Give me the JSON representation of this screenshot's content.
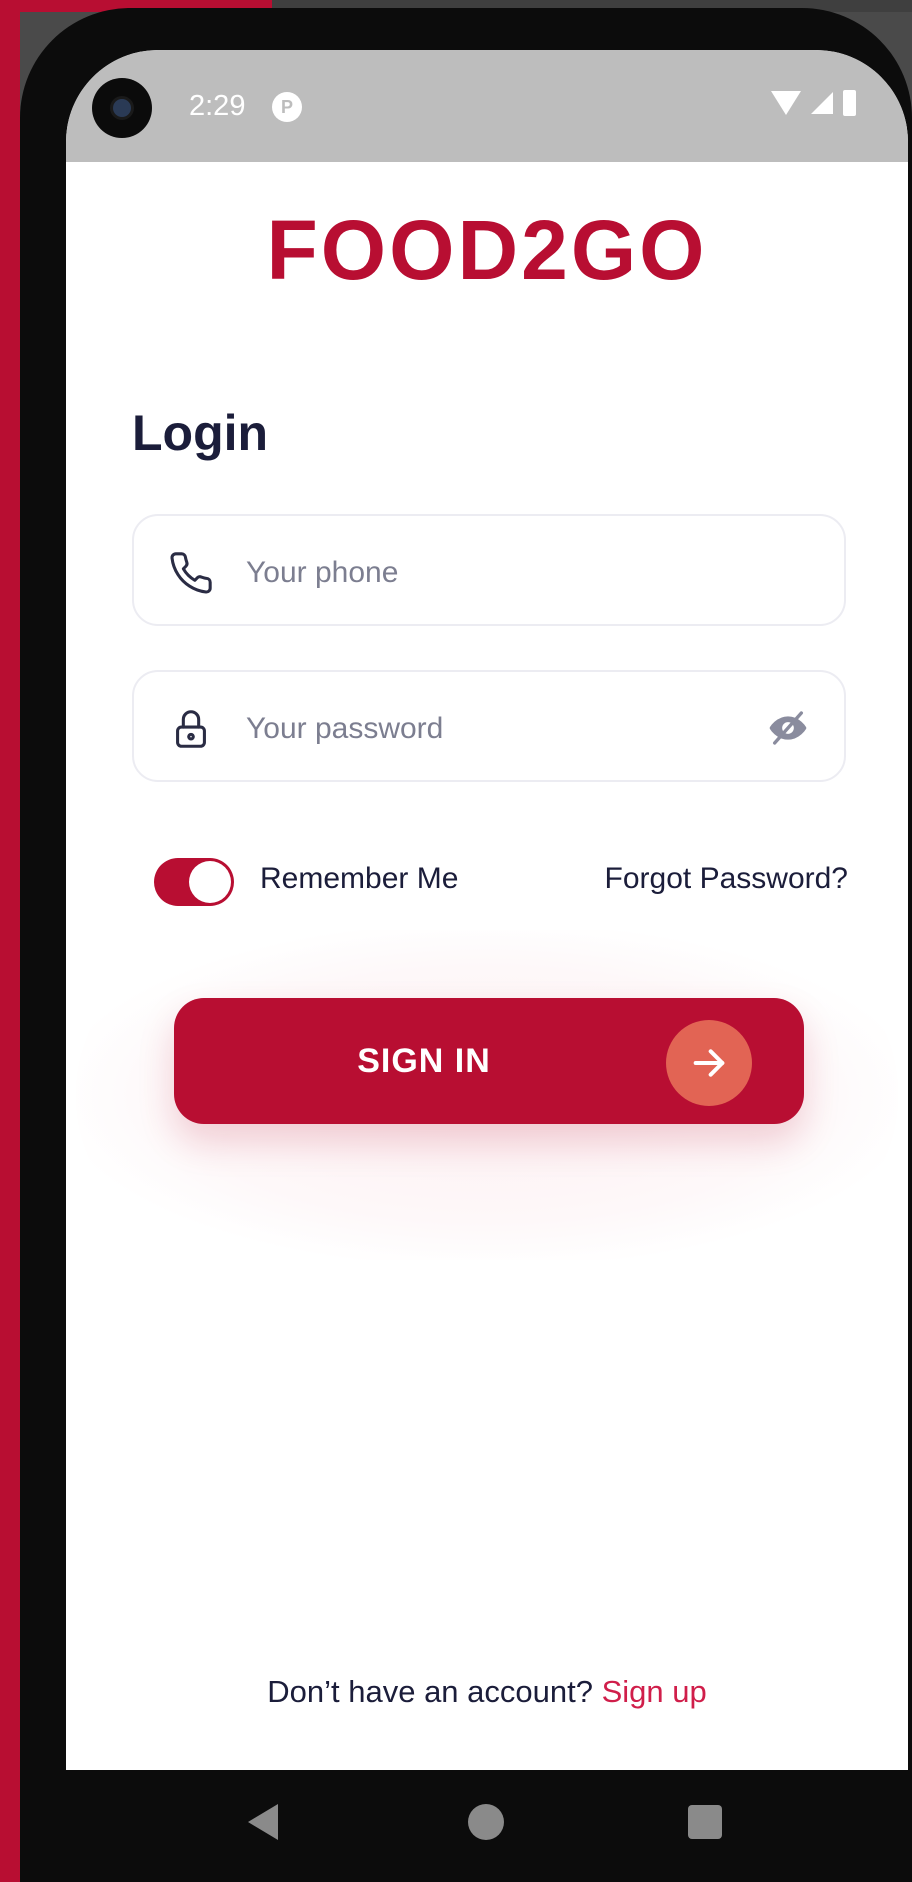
{
  "status_bar": {
    "time": "2:29",
    "notification_icon": "app-notification-icon"
  },
  "app": {
    "logo": "FOOD2GO"
  },
  "login": {
    "title": "Login",
    "phone_placeholder": "Your phone",
    "password_placeholder": "Your password",
    "remember_me": "Remember Me",
    "remember_me_on": true,
    "forgot_password": "Forgot Password?",
    "sign_in": "SIGN IN"
  },
  "footer": {
    "prompt": "Don’t have an account?",
    "signup_link": "Sign up"
  },
  "colors": {
    "brand": "#b80e32",
    "arrow_circle": "#e26454",
    "text": "#1b1d3a",
    "link": "#d01e4a"
  }
}
